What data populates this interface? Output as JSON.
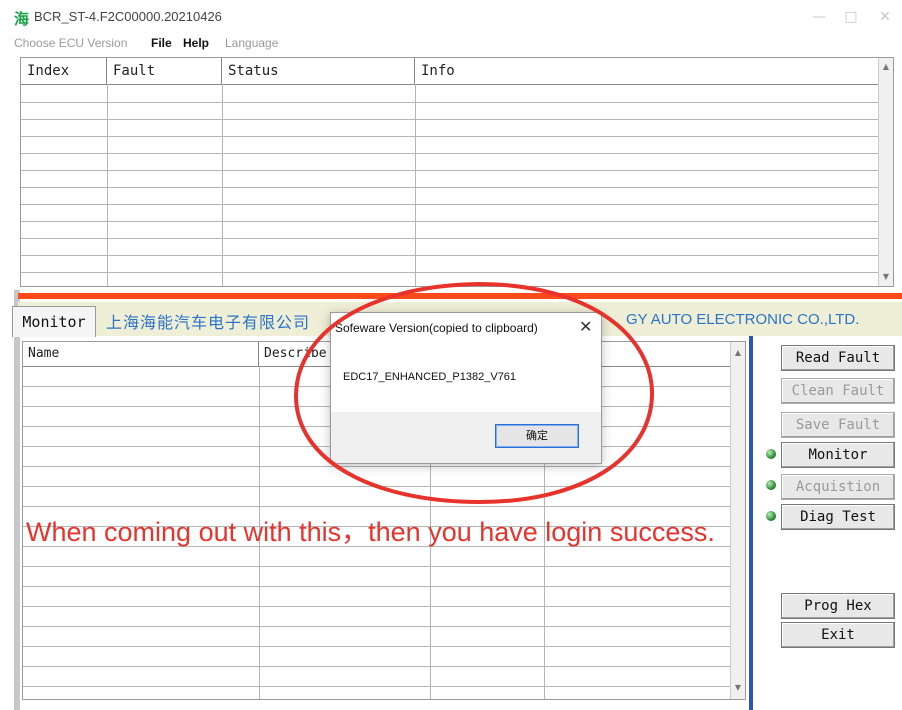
{
  "window": {
    "icon_glyph": "海",
    "title": "BCR_ST-4.F2C00000.20210426",
    "minimize_glyph": "—",
    "maximize_glyph": "□",
    "close_glyph": "✕"
  },
  "menu": {
    "items": [
      "Choose ECU Version",
      "File",
      "Help",
      "Language"
    ]
  },
  "fault_table": {
    "columns": [
      "Index",
      "Fault",
      "Status",
      "Info"
    ],
    "rows": []
  },
  "banner": {
    "tab_label": "Monitor",
    "company_cn": "上海海能汽车电子有限公司",
    "company_en": "GY AUTO ELECTRONIC CO.,LTD."
  },
  "monitor_table": {
    "columns": [
      "Name",
      "Describe",
      "",
      ""
    ],
    "rows": []
  },
  "buttons": {
    "read_fault": "Read Fault",
    "clean_fault": "Clean Fault",
    "save_fault": "Save Fault",
    "monitor": "Monitor",
    "acquistion": "Acquistion",
    "diag_test": "Diag Test",
    "prog_hex": "Prog Hex",
    "exit": "Exit"
  },
  "dialog": {
    "title": "Sofeware Version(copied to clipboard)",
    "message": "EDC17_ENHANCED_P1382_V761",
    "ok_label": "确定",
    "close_glyph": "✕"
  },
  "annotation": {
    "text": "When coming out with this，then you have login success."
  },
  "colors": {
    "annotation_red": "#e8332d",
    "company_blue": "#2a74c9",
    "divider_orange": "#ff4a1a",
    "led_green": "#1e7a2a"
  }
}
